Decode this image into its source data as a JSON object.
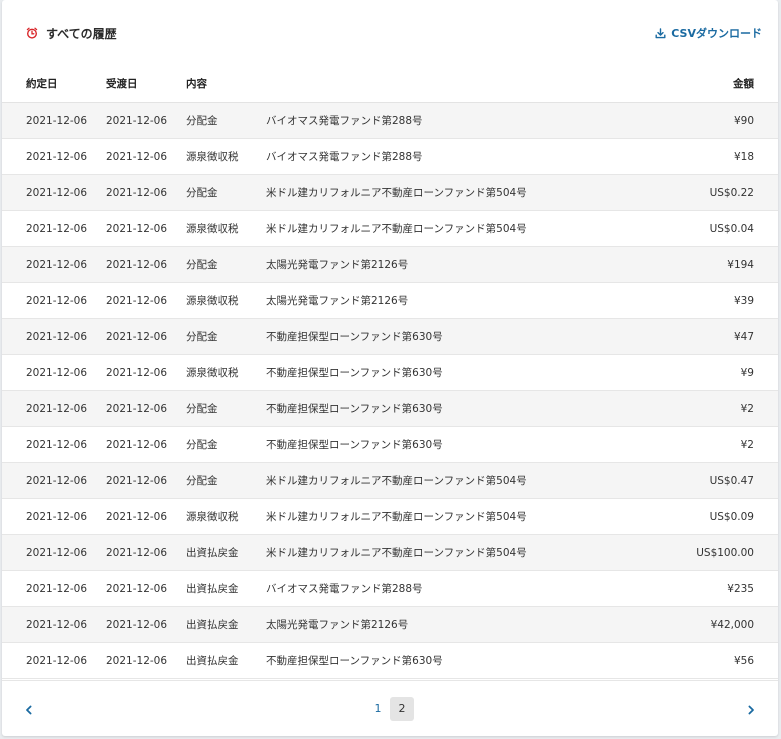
{
  "header": {
    "title": "すべての履歴",
    "title_icon": "alarm-clock-icon",
    "csv_label": "CSVダウンロード",
    "csv_icon": "download-icon"
  },
  "colors": {
    "accent": "#1a6aa1",
    "title_icon": "#d9262a",
    "stripe": "#f5f5f5"
  },
  "table": {
    "columns": [
      "約定日",
      "受渡日",
      "内容",
      "",
      "金額"
    ],
    "rows": [
      {
        "trade_date": "2021-12-06",
        "settle_date": "2021-12-06",
        "type": "分配金",
        "fund": "バイオマス発電ファンド第288号",
        "amount": "¥90"
      },
      {
        "trade_date": "2021-12-06",
        "settle_date": "2021-12-06",
        "type": "源泉徴収税",
        "fund": "バイオマス発電ファンド第288号",
        "amount": "¥18"
      },
      {
        "trade_date": "2021-12-06",
        "settle_date": "2021-12-06",
        "type": "分配金",
        "fund": "米ドル建カリフォルニア不動産ローンファンド第504号",
        "amount": "US$0.22"
      },
      {
        "trade_date": "2021-12-06",
        "settle_date": "2021-12-06",
        "type": "源泉徴収税",
        "fund": "米ドル建カリフォルニア不動産ローンファンド第504号",
        "amount": "US$0.04"
      },
      {
        "trade_date": "2021-12-06",
        "settle_date": "2021-12-06",
        "type": "分配金",
        "fund": "太陽光発電ファンド第2126号",
        "amount": "¥194"
      },
      {
        "trade_date": "2021-12-06",
        "settle_date": "2021-12-06",
        "type": "源泉徴収税",
        "fund": "太陽光発電ファンド第2126号",
        "amount": "¥39"
      },
      {
        "trade_date": "2021-12-06",
        "settle_date": "2021-12-06",
        "type": "分配金",
        "fund": "不動産担保型ローンファンド第630号",
        "amount": "¥47"
      },
      {
        "trade_date": "2021-12-06",
        "settle_date": "2021-12-06",
        "type": "源泉徴収税",
        "fund": "不動産担保型ローンファンド第630号",
        "amount": "¥9"
      },
      {
        "trade_date": "2021-12-06",
        "settle_date": "2021-12-06",
        "type": "分配金",
        "fund": "不動産担保型ローンファンド第630号",
        "amount": "¥2"
      },
      {
        "trade_date": "2021-12-06",
        "settle_date": "2021-12-06",
        "type": "分配金",
        "fund": "不動産担保型ローンファンド第630号",
        "amount": "¥2"
      },
      {
        "trade_date": "2021-12-06",
        "settle_date": "2021-12-06",
        "type": "分配金",
        "fund": "米ドル建カリフォルニア不動産ローンファンド第504号",
        "amount": "US$0.47"
      },
      {
        "trade_date": "2021-12-06",
        "settle_date": "2021-12-06",
        "type": "源泉徴収税",
        "fund": "米ドル建カリフォルニア不動産ローンファンド第504号",
        "amount": "US$0.09"
      },
      {
        "trade_date": "2021-12-06",
        "settle_date": "2021-12-06",
        "type": "出資払戻金",
        "fund": "米ドル建カリフォルニア不動産ローンファンド第504号",
        "amount": "US$100.00"
      },
      {
        "trade_date": "2021-12-06",
        "settle_date": "2021-12-06",
        "type": "出資払戻金",
        "fund": "バイオマス発電ファンド第288号",
        "amount": "¥235"
      },
      {
        "trade_date": "2021-12-06",
        "settle_date": "2021-12-06",
        "type": "出資払戻金",
        "fund": "太陽光発電ファンド第2126号",
        "amount": "¥42,000"
      },
      {
        "trade_date": "2021-12-06",
        "settle_date": "2021-12-06",
        "type": "出資払戻金",
        "fund": "不動産担保型ローンファンド第630号",
        "amount": "¥56"
      }
    ]
  },
  "pagination": {
    "prev_icon": "chevron-left-icon",
    "next_icon": "chevron-right-icon",
    "pages": [
      "1",
      "2"
    ],
    "current_page": "2"
  }
}
